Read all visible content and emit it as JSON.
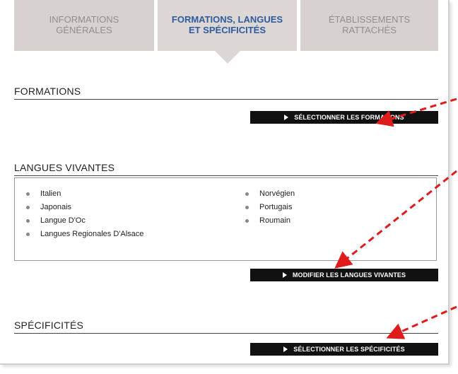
{
  "tabs": [
    {
      "line1": "INFORMATIONS",
      "line2": "GÉNÉRALES"
    },
    {
      "line1": "FORMATIONS, LANGUES",
      "line2": "ET SPÉCIFICITÉS"
    },
    {
      "line1": "ÉTABLISSEMENTS",
      "line2": "RATTACHÉS"
    }
  ],
  "sections": {
    "formations": {
      "title": "FORMATIONS",
      "button": "SÉLECTIONNER LES FORMATIONS"
    },
    "langues": {
      "title": "LANGUES VIVANTES",
      "button": "MODIFIER LES LANGUES VIVANTES",
      "left": [
        "Italien",
        "Japonais",
        "Langue D'Oc",
        "Langues Regionales D'Alsace"
      ],
      "right": [
        "Norvégien",
        "Portugais",
        "Roumain"
      ]
    },
    "specificites": {
      "title": "SPÉCIFICITÉS",
      "button": "SÉLECTIONNER LES SPÉCIFICITÉS"
    }
  },
  "colors": {
    "tab_bg": "#d7d2cf",
    "tab_active_text": "#2f5a9e",
    "button_bg": "#111111",
    "annotation_arrow": "#e01b1b"
  }
}
